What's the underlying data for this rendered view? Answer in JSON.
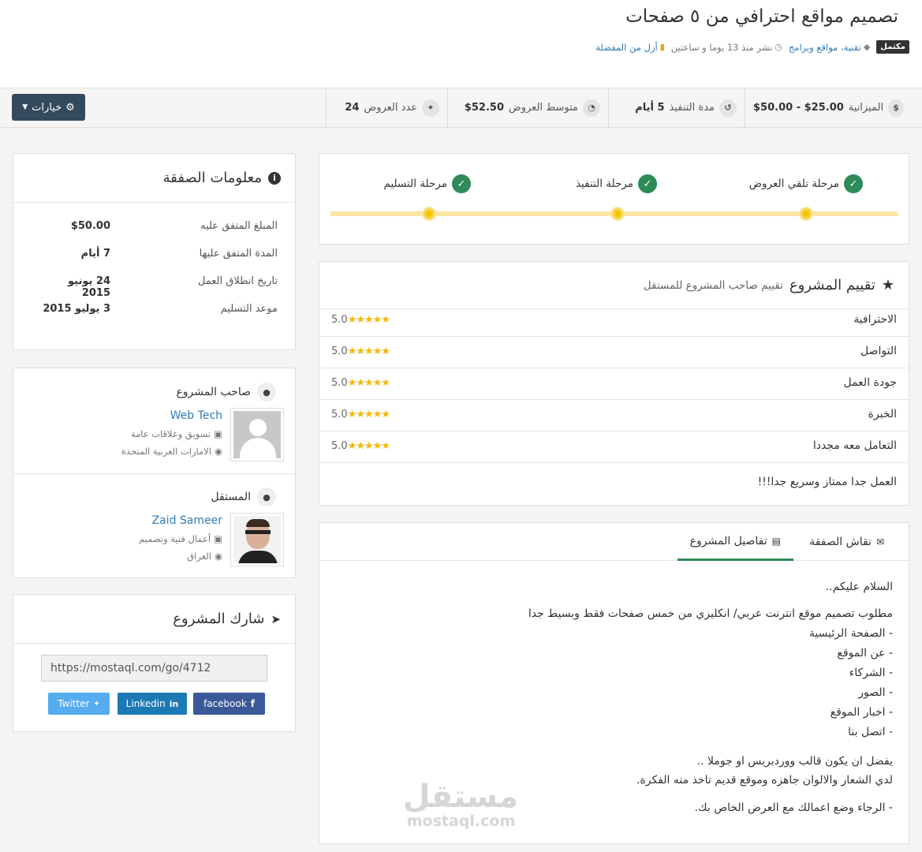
{
  "project": {
    "title": "تصميم مواقع احترافي من ٥ صفحات",
    "status": "مكتمل",
    "category": "تقنية، مواقع وبرامج",
    "posted": "نشر منذ 13 يوما و ساعتين",
    "favorite": "أزل من المفضلة"
  },
  "stats": {
    "budget_label": "الميزانية",
    "budget_value": "$25.00 - $50.00",
    "duration_label": "مدة التنفيذ",
    "duration_value": "5 أيام",
    "avg_label": "متوسط العروض",
    "avg_value": "$52.50",
    "bids_label": "عدد العروض",
    "bids_value": "24",
    "options_label": "خيارات"
  },
  "deal_info": {
    "title": "معلومات الصفقة",
    "rows": [
      {
        "label": "المبلغ المتفق عليه",
        "value": "$50.00"
      },
      {
        "label": "المدة المتفق عليها",
        "value": "7 أيام"
      },
      {
        "label": "تاريخ انطلاق العمل",
        "value": "24 يونيو 2015"
      },
      {
        "label": "موعد التسليم",
        "value": "3 يوليو 2015"
      }
    ]
  },
  "owner": {
    "label": "صاحب المشروع",
    "name": "Web Tech",
    "field": "تسويق وعلاقات عامة",
    "location": "الامارات العربية المتحدة"
  },
  "freelancer": {
    "label": "المستقل",
    "name": "Zaid Sameer",
    "field": "أعمال فنية وتصميم",
    "location": "العراق"
  },
  "share": {
    "title": "شارك المشروع",
    "url": "https://mostaql.com/go/4712",
    "twitter": "Twitter",
    "linkedin": "Linkedin",
    "facebook": "facebook"
  },
  "stages": [
    {
      "label": "مرحلة تلقي العروض"
    },
    {
      "label": "مرحلة التنفيذ"
    },
    {
      "label": "مرحلة التسليم"
    }
  ],
  "rating": {
    "title": "تقييم المشروع",
    "subtitle": "تقييم صاحب المشروع للمستقل",
    "rows": [
      {
        "label": "الاحترافية",
        "value": "5.0",
        "stars": 5
      },
      {
        "label": "التواصل",
        "value": "5.0",
        "stars": 5
      },
      {
        "label": "جودة العمل",
        "value": "5.0",
        "stars": 5
      },
      {
        "label": "الخبرة",
        "value": "5.0",
        "stars": 5
      },
      {
        "label": "التعامل معه مجددا",
        "value": "5.0",
        "stars": 5
      }
    ],
    "comment": "العمل جدا ممتاز وسريع جدا!!!"
  },
  "tabs": {
    "details": "تفاصيل المشروع",
    "discussion": "نقاش الصفقة"
  },
  "description": [
    "السلام عليكم..",
    "مطلوب تصميم موقع انترنت عربي/ انكليزي من خمس صفحات فقط وبسيط جدا",
    "- الصفحة الرئيسية",
    "- عن الموقع",
    "- الشركاء",
    "- الصور",
    "- اخبار الموقع",
    "- اتصل بنا",
    "يفضل ان يكون قالب ووردبريس او جوملا ..",
    "لدي الشعار والالوان جاهزه وموقع قديم تاخذ منه الفكرة.",
    "- الرجاء وضع اعمالك مع العرض الخاص بك."
  ],
  "watermark": {
    "arabic": "مستقل",
    "latin": "mostaql.com"
  },
  "colors": {
    "accent": "#2f7ab6",
    "success": "#2e8b57",
    "star": "#f5b800",
    "options_button": "#34495e"
  }
}
